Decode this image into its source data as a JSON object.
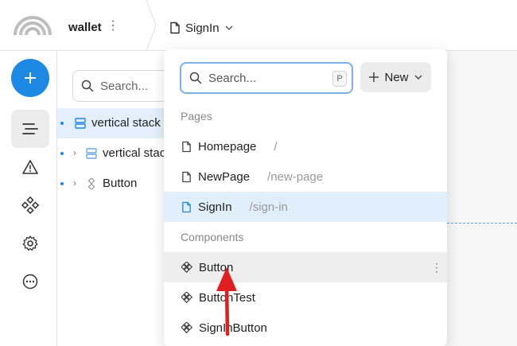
{
  "header": {
    "app_name": "wallet",
    "current_page": "SignIn"
  },
  "layers": {
    "search_placeholder": "Search...",
    "items": [
      {
        "label": "vertical stack"
      },
      {
        "label": "vertical stack"
      },
      {
        "label": "Button"
      }
    ]
  },
  "dropdown": {
    "search_placeholder": "Search...",
    "search_shortcut": "P",
    "new_label": "New",
    "pages_section": "Pages",
    "pages": [
      {
        "name": "Homepage",
        "path": "/"
      },
      {
        "name": "NewPage",
        "path": "/new-page"
      },
      {
        "name": "SignIn",
        "path": "/sign-in"
      }
    ],
    "components_section": "Components",
    "components": [
      {
        "name": "Button"
      },
      {
        "name": "ButtonTest"
      },
      {
        "name": "SignInButton"
      }
    ]
  },
  "colors": {
    "accent": "#1e88e5",
    "selected_bg": "#e1eefc",
    "annotation_arrow": "#e02020"
  },
  "icons": {
    "logo": "rainbow-logo-icon",
    "page": "page-icon",
    "component": "component-icon",
    "stack": "vertical-stack-icon"
  }
}
